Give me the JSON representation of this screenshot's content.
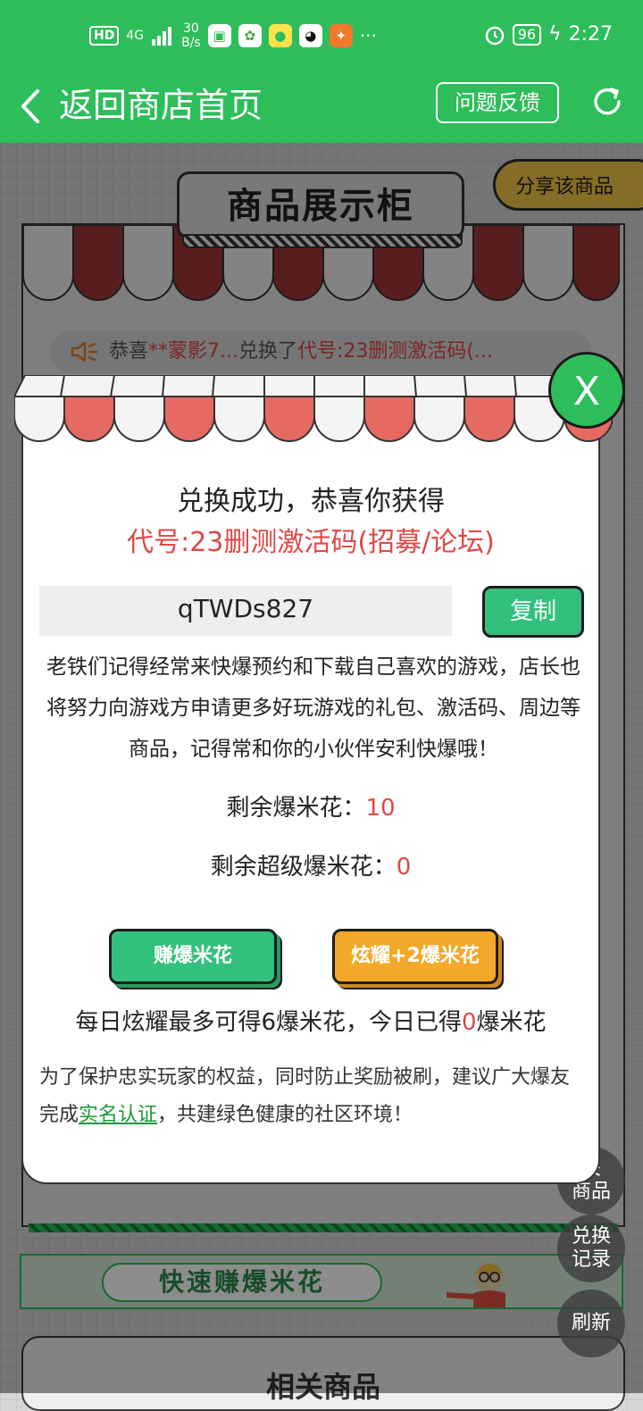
{
  "status_bar": {
    "hd": "HD",
    "signal": "4G",
    "speed_top": "30",
    "speed_bottom": "B/s",
    "more": "···",
    "battery": "96",
    "time": "2:27"
  },
  "header": {
    "title": "返回商店首页",
    "feedback": "问题反馈"
  },
  "page": {
    "share": "分享该商品",
    "sign": "商品展示柜",
    "notice_prefix": "恭喜",
    "notice_user": "**蒙影7...",
    "notice_mid": "兑换了",
    "notice_item": "代号:23删测激活码(...",
    "quick_earn": "快速赚爆米花",
    "related_title": "相关商品"
  },
  "floating": {
    "collect_line1": "关",
    "collect_line2": "商品",
    "history_line1": "兑换",
    "history_line2": "记录",
    "refresh": "刷新"
  },
  "modal": {
    "close": "X",
    "title": "兑换成功，恭喜你获得",
    "prize": "代号:23删测激活码(招募/论坛)",
    "code": "qTWDs827",
    "copy": "复制",
    "description": "老铁们记得经常来快爆预约和下载自己喜欢的游戏，店长也将努力向游戏方申请更多好玩游戏的礼包、激活码、周边等商品，记得常和你的小伙伴安利快爆哦！",
    "remain_label": "剩余爆米花：",
    "remain_value": "10",
    "super_label": "剩余超级爆米花：",
    "super_value": "0",
    "earn_btn": "赚爆米花",
    "show_btn": "炫耀+2爆米花",
    "daily_prefix": "每日炫耀最多可得6爆米花，今日已得",
    "daily_value": "0",
    "daily_suffix": "爆米花",
    "notice_prefix": "为了保护忠实玩家的权益，同时防止奖励被刷，建议广大爆友完成",
    "notice_link": "实名认证",
    "notice_suffix": "，共建绿色健康的社区环境！"
  },
  "colors": {
    "brand_green": "#2ebd5b",
    "button_green": "#33c07c",
    "button_orange": "#f4a829",
    "highlight_red": "#e04848",
    "share_yellow": "#f3c548"
  }
}
